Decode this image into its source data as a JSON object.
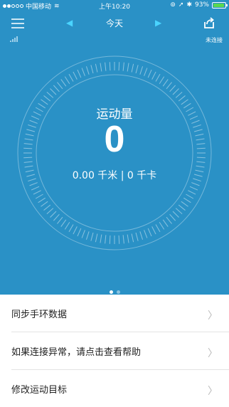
{
  "status_bar": {
    "carrier": "中国移动",
    "time": "上午10:20",
    "battery_percent": "93%",
    "battery_level": 0.93
  },
  "header": {
    "title": "今天",
    "connection_status": "未连接"
  },
  "activity": {
    "label": "运动量",
    "steps": "0",
    "summary": "0.00 千米 | 0 千卡"
  },
  "pager": {
    "pages": 2,
    "active_index": 0
  },
  "menu": {
    "items": [
      {
        "label": "同步手环数据"
      },
      {
        "label": "如果连接异常，请点击查看帮助"
      },
      {
        "label": "修改运动目标"
      }
    ]
  },
  "colors": {
    "hero_background": "#2a91c6",
    "arrow_accent": "#4ad4ff",
    "battery_fill": "#5ad84f"
  }
}
